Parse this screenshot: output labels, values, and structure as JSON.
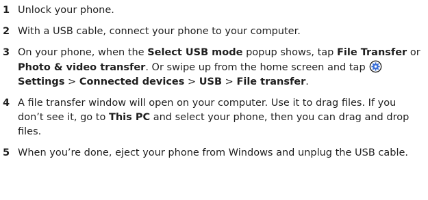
{
  "steps": [
    {
      "number": "1",
      "parts": [
        {
          "t": "Unlock your phone."
        }
      ]
    },
    {
      "number": "2",
      "parts": [
        {
          "t": "With a USB cable, connect your phone to your computer."
        }
      ]
    },
    {
      "number": "3",
      "parts": [
        {
          "t": "On your phone, when the "
        },
        {
          "t": "Select USB mode",
          "b": true
        },
        {
          "t": " popup shows, tap "
        },
        {
          "t": "File Transfer",
          "b": true
        },
        {
          "t": " or "
        },
        {
          "t": "Photo & video transfer",
          "b": true
        },
        {
          "t": ". Or swipe up from the home screen and tap "
        },
        {
          "icon": "settings-gear-icon"
        },
        {
          "t": "Settings",
          "b": true
        },
        {
          "t": " > "
        },
        {
          "t": "Connected devices",
          "b": true
        },
        {
          "t": " > "
        },
        {
          "t": "USB",
          "b": true
        },
        {
          "t": " > "
        },
        {
          "t": "File transfer",
          "b": true
        },
        {
          "t": "."
        }
      ]
    },
    {
      "number": "4",
      "parts": [
        {
          "t": "A file transfer window will open on your computer. Use it to drag files. If you don’t see it, go to "
        },
        {
          "t": "This PC",
          "b": true
        },
        {
          "t": " and select your phone, then you can drag and drop files."
        }
      ]
    },
    {
      "number": "5",
      "parts": [
        {
          "t": "When you’re done, eject your phone from Windows and unplug the USB cable."
        }
      ]
    }
  ],
  "colors": {
    "text": "#1f1f1f",
    "icon_fill": "#3b6fd8",
    "icon_border": "#1f1f1f"
  }
}
